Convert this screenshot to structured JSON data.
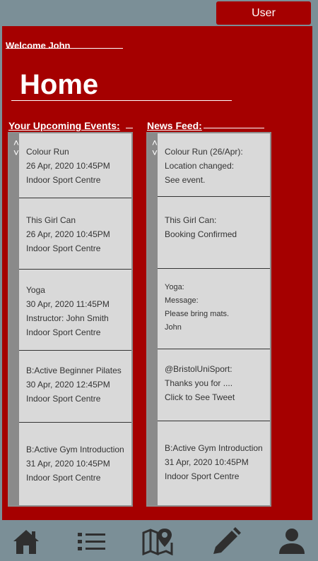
{
  "header": {
    "user_label": "User"
  },
  "welcome": "Welcome John",
  "title": "Home",
  "events": {
    "heading": "Your Upcoming Events:",
    "items": [
      {
        "lines": [
          "Colour Run",
          "26 Apr, 2020 10:45PM",
          "Indoor Sport Centre"
        ]
      },
      {
        "lines": [
          "This Girl Can",
          "26 Apr, 2020 10:45PM",
          "Indoor Sport Centre"
        ]
      },
      {
        "lines": [
          "Yoga",
          "30 Apr, 2020 11:45PM",
          "Instructor: John Smith",
          "Indoor Sport Centre"
        ]
      },
      {
        "lines": [
          "B:Active Beginner Pilates",
          "30 Apr, 2020 12:45PM",
          "Indoor Sport Centre"
        ]
      },
      {
        "lines": [
          "B:Active Gym Introduction",
          "31 Apr, 2020 10:45PM",
          "Indoor Sport Centre"
        ]
      }
    ]
  },
  "news": {
    "heading": "News Feed:",
    "items": [
      {
        "lines": [
          "Colour Run (26/Apr):",
          "Location changed:",
          "See event."
        ]
      },
      {
        "lines": [
          "This Girl Can:",
          "Booking Confirmed"
        ]
      },
      {
        "lines": [
          "Yoga:",
          "Message:",
          "Please bring mats.",
          "John"
        ]
      },
      {
        "lines": [
          "@BristolUniSport:",
          "Thanks you for ....",
          "Click to See Tweet"
        ]
      },
      {
        "lines": [
          "B:Active Gym Introduction",
          "31 Apr, 2020 10:45PM",
          "Indoor Sport Centre"
        ]
      }
    ]
  },
  "nav": [
    {
      "icon": "home-icon"
    },
    {
      "icon": "list-icon"
    },
    {
      "icon": "map-icon"
    },
    {
      "icon": "pencil-icon"
    },
    {
      "icon": "profile-icon"
    }
  ],
  "colors": {
    "primary": "#a50000",
    "bar": "#7b8f97",
    "card": "#d9d9d9",
    "icon": "#2f2f2f"
  }
}
